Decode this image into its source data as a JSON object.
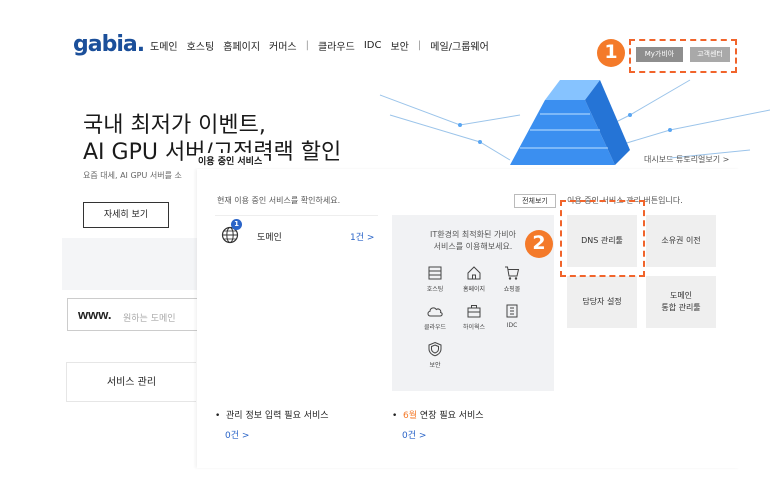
{
  "header": {
    "logo": "gabia.",
    "nav": [
      "도메인",
      "호스팅",
      "홈페이지",
      "커머스",
      "클라우드",
      "IDC",
      "보안",
      "메일/그룹웨어"
    ],
    "separator": "|",
    "mygabia_btn": "My가비아",
    "support_btn": "고객센터"
  },
  "steps": {
    "one": "1",
    "two": "2"
  },
  "hero": {
    "title_line1": "국내 최저가 이벤트,",
    "title_line2": "AI GPU 서버/고전력랙 할인",
    "subtitle": "요즘 대세, AI GPU 서버를 소",
    "cta": "자세히 보기"
  },
  "domain_search": {
    "prefix": "www.",
    "placeholder": "원하는 도메인"
  },
  "service_tab": "서비스 관리",
  "dashboard_tutorial": "대시보드 튜토리얼보기 >",
  "panel": {
    "label": "이용 중인 서비스",
    "desc": "현재 이용 중인 서비스를 확인하세요.",
    "view_all": "전체보기",
    "mgmt_desc": "이용 중인 서비스 관리 버튼입니다.",
    "service": {
      "badge": "1",
      "name": "도메인",
      "count": "1건 >"
    },
    "promo_line1": "IT환경의 최적화된 가비아",
    "promo_line2": "서비스를 이용해보세요.",
    "promo_icons": {
      "hosting": "호스팅",
      "homepage": "홈페이지",
      "shopping": "쇼핑몰",
      "cloud": "클라우드",
      "hiworks": "하이웍스",
      "idc": "IDC",
      "security": "보안"
    },
    "mgmt_buttons": {
      "dns": "DNS 관리툴",
      "owner": "소유권 이전",
      "contact": "담당자 설정",
      "domain_line1": "도메인",
      "domain_line2": "통합 관리툴"
    },
    "footer": {
      "left_prefix": "관리 정보 입력 필요 서비스",
      "left_count": "0건 >",
      "right_highlight": "6월",
      "right_suffix": " 연장 필요 서비스",
      "right_count": "0건 >"
    }
  },
  "colors": {
    "brand": "#1b4f9a",
    "accent": "#f47a2a",
    "link": "#2a64c8"
  }
}
